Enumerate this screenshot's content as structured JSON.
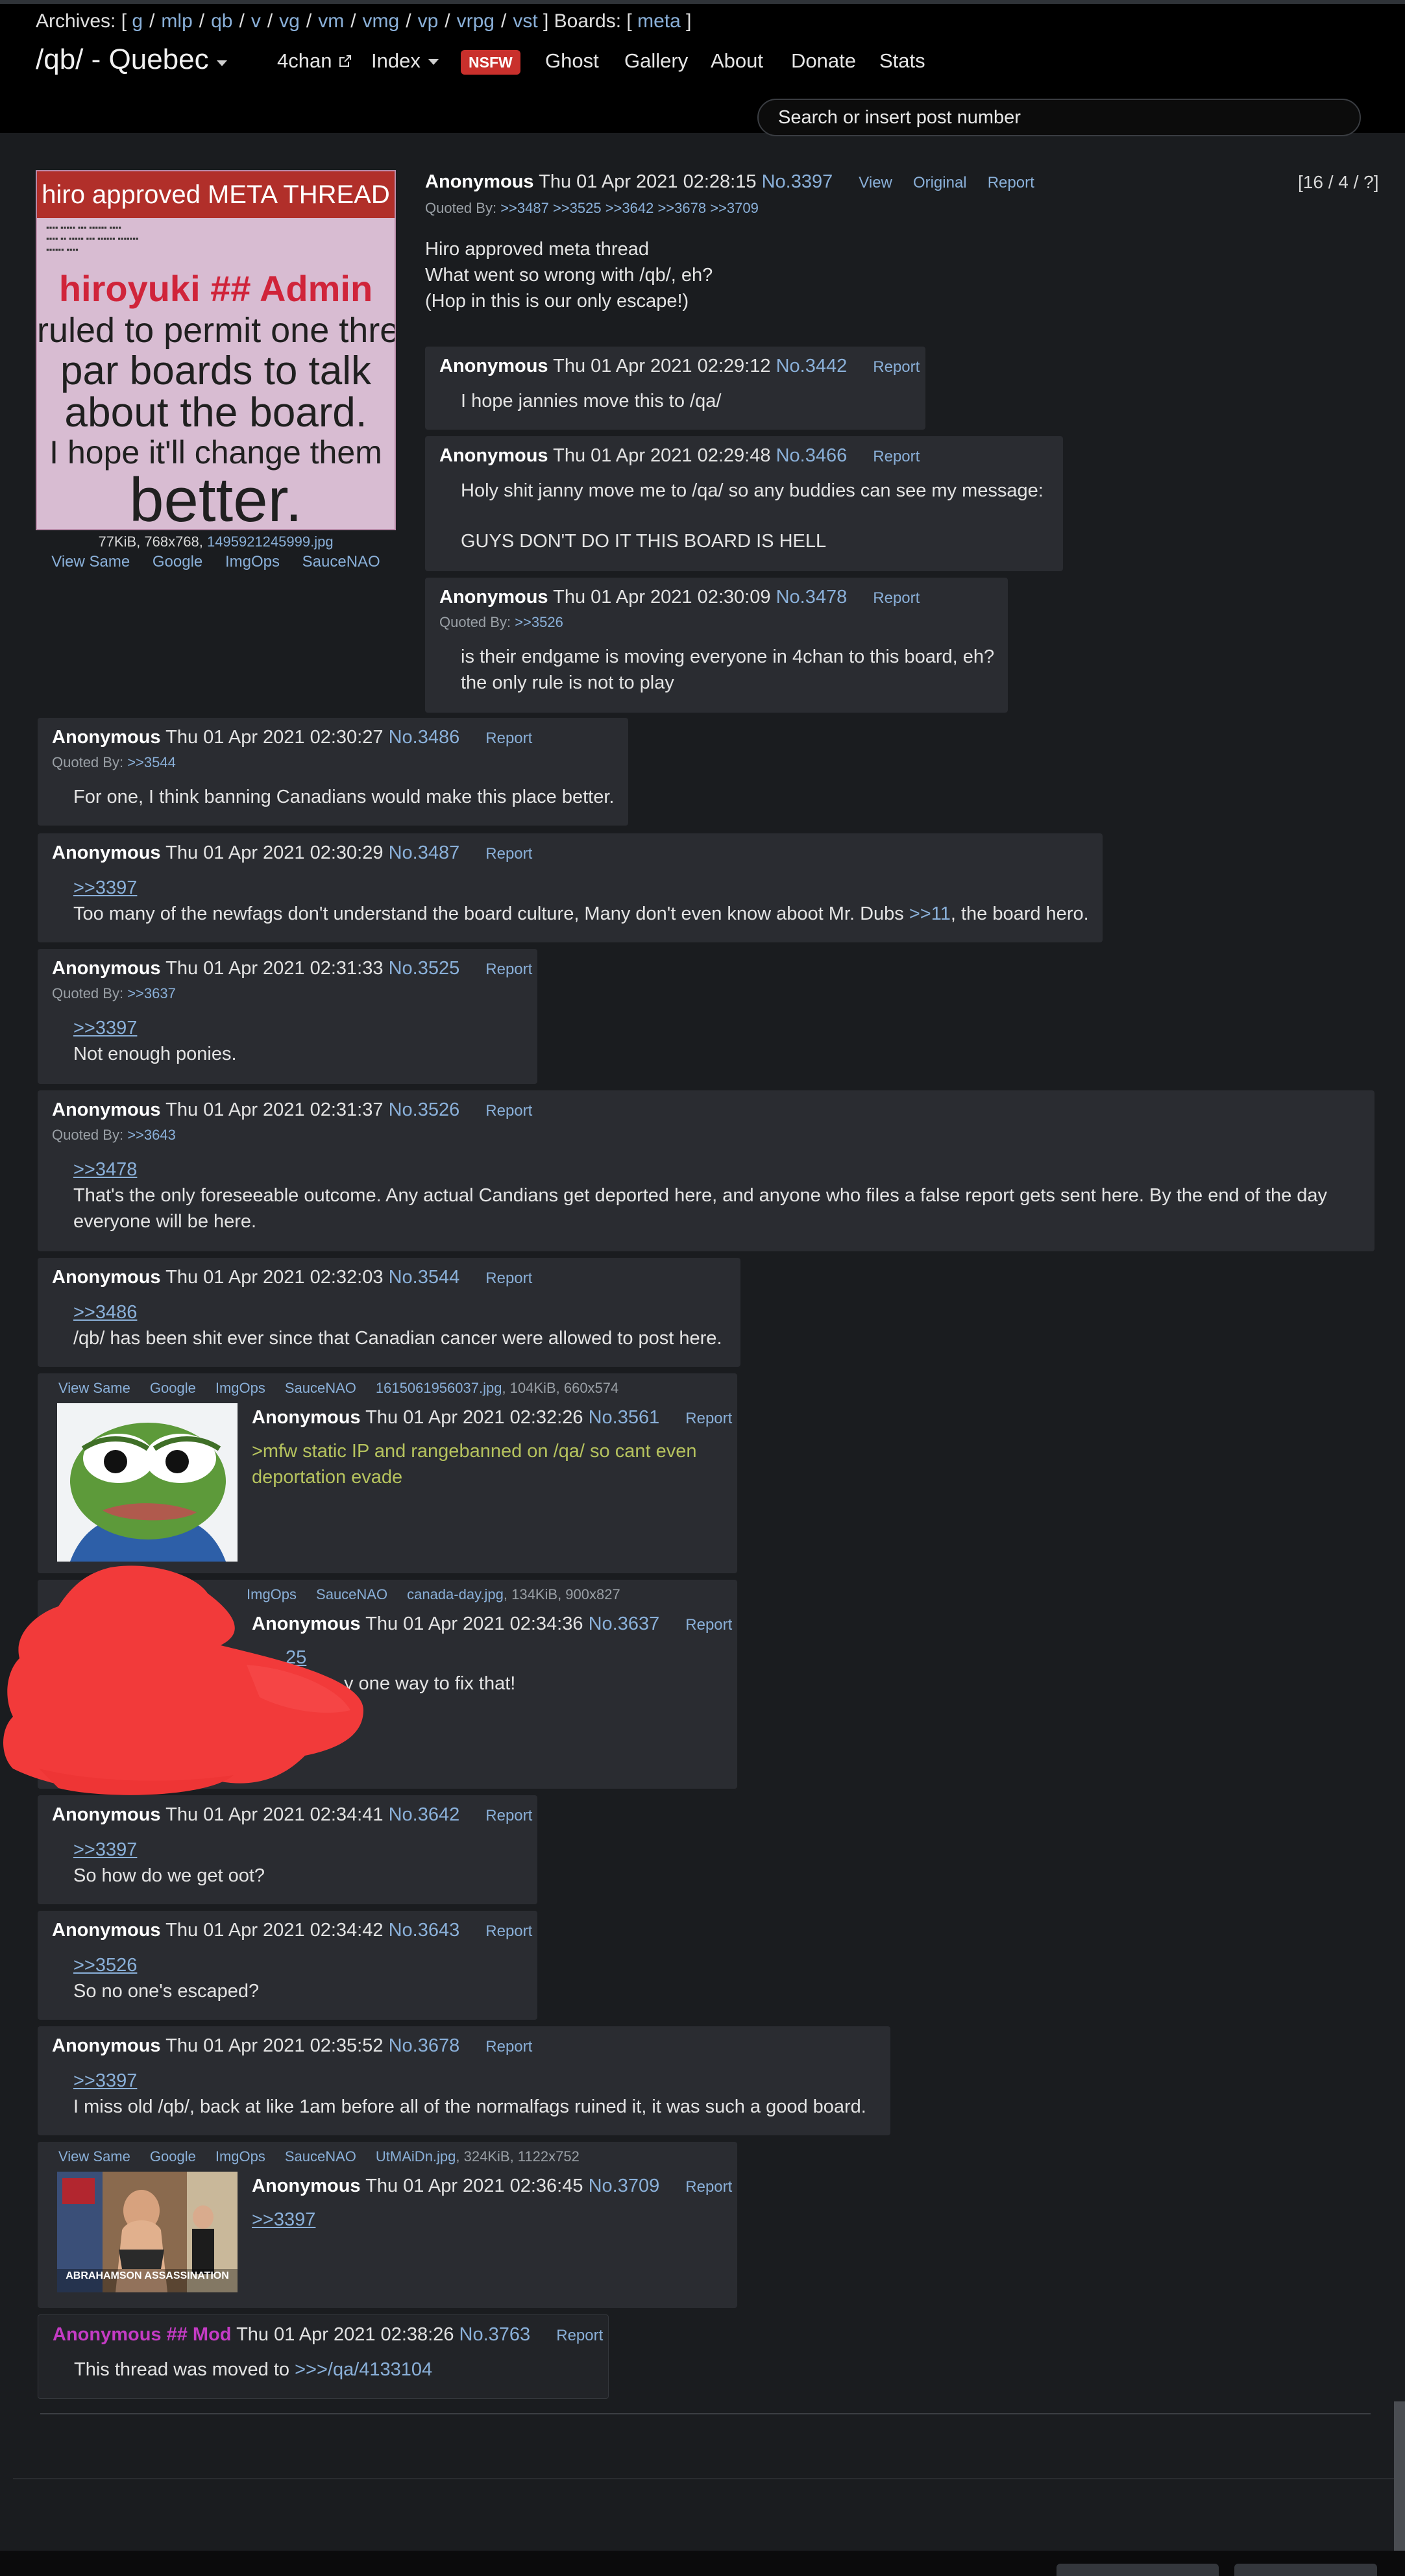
{
  "top_nav": {
    "archives_label": "Archives: [",
    "archives": [
      "g",
      "mlp",
      "qb",
      "v",
      "vg",
      "vm",
      "vmg",
      "vp",
      "vrpg",
      "vst"
    ],
    "boards_label": "] Boards: [",
    "boards": [
      "meta"
    ],
    "boards_close": "]",
    "board_title": "/qb/ - Quebec",
    "fourchan": "4chan",
    "index": "Index",
    "nsfw": "NSFW",
    "ghost": "Ghost",
    "gallery": "Gallery",
    "about": "About",
    "donate": "Donate",
    "stats": "Stats",
    "search_placeholder": "Search or insert post number"
  },
  "thread_stats": "[16 / 4 / ?]",
  "op": {
    "image_lines": {
      "banner": "hiro approved META THREAD",
      "red": "hiroyuki ## Admin",
      "l1": "ruled to permit one thread",
      "l2": "par boards to talk",
      "l3": "about the board.",
      "l4": "I hope it'll change them",
      "l5": "better."
    },
    "image_meta_prefix": "77KiB, 768x768,",
    "image_filename": "1495921245999.jpg",
    "image_links": [
      "View Same",
      "Google",
      "ImgOps",
      "SauceNAO"
    ],
    "name": "Anonymous",
    "date": "Thu 01 Apr 2021 02:28:15",
    "number": "No.3397",
    "actions": [
      "View",
      "Original",
      "Report"
    ],
    "quoted_label": "Quoted By:",
    "quoted_by": ">>3487 >>3525 >>3642 >>3678 >>3709",
    "body": [
      "Hiro approved meta thread",
      "What went so wrong with /qb/, eh?",
      "(Hop in this is our only escape!)"
    ]
  },
  "posts": {
    "p3442": {
      "name": "Anonymous",
      "date": "Thu 01 Apr 2021 02:29:12",
      "number": "No.3442",
      "report": "Report",
      "body": "I hope jannies move this to /qa/"
    },
    "p3466": {
      "name": "Anonymous",
      "date": "Thu 01 Apr 2021 02:29:48",
      "number": "No.3466",
      "report": "Report",
      "body1": "Holy shit janny move me to /qa/ so any buddies can see my message:",
      "body2": "GUYS DON'T DO IT THIS BOARD IS HELL"
    },
    "p3478": {
      "name": "Anonymous",
      "date": "Thu 01 Apr 2021 02:30:09",
      "number": "No.3478",
      "report": "Report",
      "quoted_label": "Quoted By:",
      "quoted_by": ">>3526",
      "body1": "is their endgame is moving everyone in 4chan to this board, eh?",
      "body2": "the only rule is not to play"
    },
    "p3486": {
      "name": "Anonymous",
      "date": "Thu 01 Apr 2021 02:30:27",
      "number": "No.3486",
      "report": "Report",
      "quoted_label": "Quoted By:",
      "quoted_by": ">>3544",
      "body": "For one, I think banning Canadians would make this place better."
    },
    "p3487": {
      "name": "Anonymous",
      "date": "Thu 01 Apr 2021 02:30:29",
      "number": "No.3487",
      "report": "Report",
      "quote": ">>3397",
      "body_a": "Too many of the newfags don't understand the board culture, Many don't even know aboot Mr. Dubs ",
      "body_link": ">>11",
      "body_b": ", the board hero."
    },
    "p3525": {
      "name": "Anonymous",
      "date": "Thu 01 Apr 2021 02:31:33",
      "number": "No.3525",
      "report": "Report",
      "quoted_label": "Quoted By:",
      "quoted_by": ">>3637",
      "quote": ">>3397",
      "body": "Not enough ponies."
    },
    "p3526": {
      "name": "Anonymous",
      "date": "Thu 01 Apr 2021 02:31:37",
      "number": "No.3526",
      "report": "Report",
      "quoted_label": "Quoted By:",
      "quoted_by": ">>3643",
      "quote": ">>3478",
      "body1": "That's the only foreseeable outcome. Any actual Candians get deported here, and anyone who files a false report gets sent here. By the end of the day",
      "body2": "everyone will be here."
    },
    "p3544": {
      "name": "Anonymous",
      "date": "Thu 01 Apr 2021 02:32:03",
      "number": "No.3544",
      "report": "Report",
      "quote": ">>3486",
      "body": "/qb/ has been shit ever since that Canadian cancer were allowed to post here."
    },
    "p3561": {
      "image_links": [
        "View Same",
        "Google",
        "ImgOps",
        "SauceNAO"
      ],
      "filename": "1615061956037.jpg",
      "filemeta": ", 104KiB, 660x574",
      "name": "Anonymous",
      "date": "Thu 01 Apr 2021 02:32:26",
      "number": "No.3561",
      "report": "Report",
      "body1": ">mfw static IP and rangebanned on /qa/ so cant even",
      "body2": "deportation evade"
    },
    "p3637": {
      "image_links": [
        "ImgOps",
        "SauceNAO"
      ],
      "filename": "canada-day.jpg",
      "filemeta": ", 134KiB, 900x827",
      "name": "Anonymous",
      "date": "Thu 01 Apr 2021 02:34:36",
      "number": "No.3637",
      "report": "Report",
      "quote": "25",
      "body": "y one way to fix that!"
    },
    "p3642": {
      "name": "Anonymous",
      "date": "Thu 01 Apr 2021 02:34:41",
      "number": "No.3642",
      "report": "Report",
      "quote": ">>3397",
      "body": "So how do we get oot?"
    },
    "p3643": {
      "name": "Anonymous",
      "date": "Thu 01 Apr 2021 02:34:42",
      "number": "No.3643",
      "report": "Report",
      "quote": ">>3526",
      "body": "So no one's escaped?"
    },
    "p3678": {
      "name": "Anonymous",
      "date": "Thu 01 Apr 2021 02:35:52",
      "number": "No.3678",
      "report": "Report",
      "quote": ">>3397",
      "body": "I miss old /qb/, back at like 1am before all of the normalfags ruined it, it was such a good board."
    },
    "p3709": {
      "image_links": [
        "View Same",
        "Google",
        "ImgOps",
        "SauceNAO"
      ],
      "filename": "UtMAiDn.jpg",
      "filemeta": ", 324KiB, 1122x752",
      "name": "Anonymous",
      "date": "Thu 01 Apr 2021 02:36:45",
      "number": "No.3709",
      "report": "Report",
      "quote": ">>3397",
      "thumb_caption": "ABRAHAMSON ASSASSINATION"
    },
    "p3763": {
      "name": "Anonymous ## Mod",
      "date": "Thu 01 Apr 2021 02:38:26",
      "number": "No.3763",
      "report": "Report",
      "body_a": "This thread was moved to ",
      "body_link": ">>>/qa/4133104"
    }
  },
  "colors": {
    "background": "#1a1c1f",
    "post_bg": "#2a2c31",
    "link": "#8ab0d9",
    "greentext": "#b6c35e",
    "mod_name": "#c43bc4",
    "nsfw": "#c9302c"
  }
}
